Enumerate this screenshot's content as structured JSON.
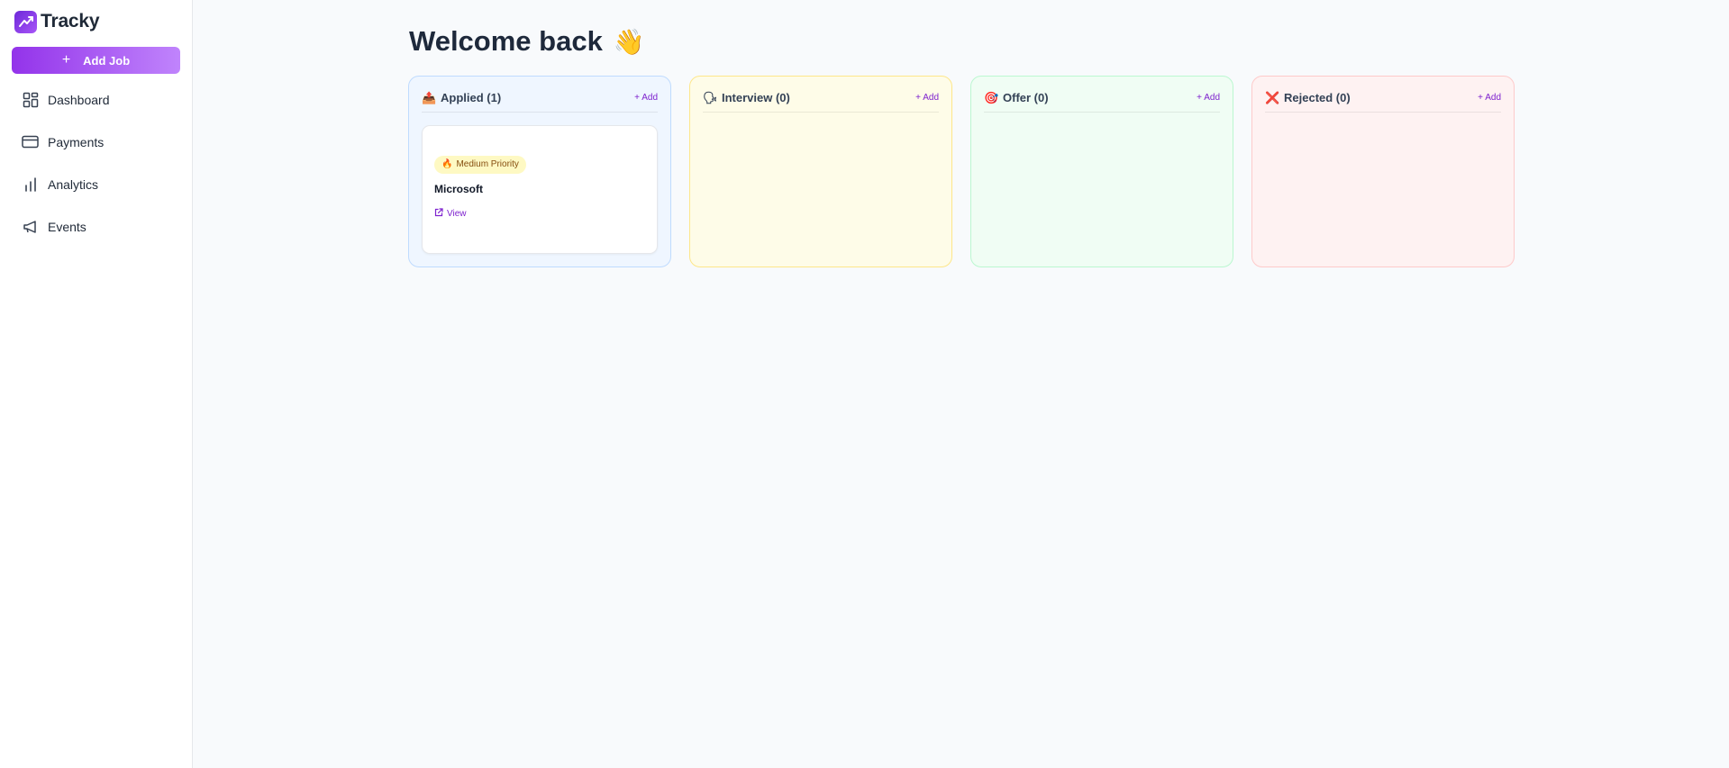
{
  "brand": {
    "name": "Tracky"
  },
  "sidebar": {
    "add_job_label": "Add Job",
    "items": [
      {
        "label": "Dashboard",
        "icon": "dashboard-icon"
      },
      {
        "label": "Payments",
        "icon": "credit-card-icon"
      },
      {
        "label": "Analytics",
        "icon": "bar-chart-icon"
      },
      {
        "label": "Events",
        "icon": "megaphone-icon"
      }
    ]
  },
  "main": {
    "welcome": "Welcome back",
    "wave": "👋"
  },
  "columns": [
    {
      "title": "Applied (1)",
      "emoji": "📤",
      "add_label": "+ Add",
      "accent": "#eff6ff"
    },
    {
      "title": "Interview (0)",
      "emoji": "🗣",
      "add_label": "+ Add",
      "accent": "#fefce8"
    },
    {
      "title": "Offer (0)",
      "emoji": "🎯",
      "add_label": "+ Add",
      "accent": "#f0fdf4"
    },
    {
      "title": "Rejected (0)",
      "emoji": "❌",
      "add_label": "+ Add",
      "accent": "#fef2f2"
    }
  ],
  "job_card": {
    "priority": "Medium Priority",
    "priority_emoji": "🔥",
    "company": "Microsoft",
    "view_label": "View"
  },
  "colors": {
    "primary": "#9333ea",
    "primary_light": "#c084fc"
  }
}
